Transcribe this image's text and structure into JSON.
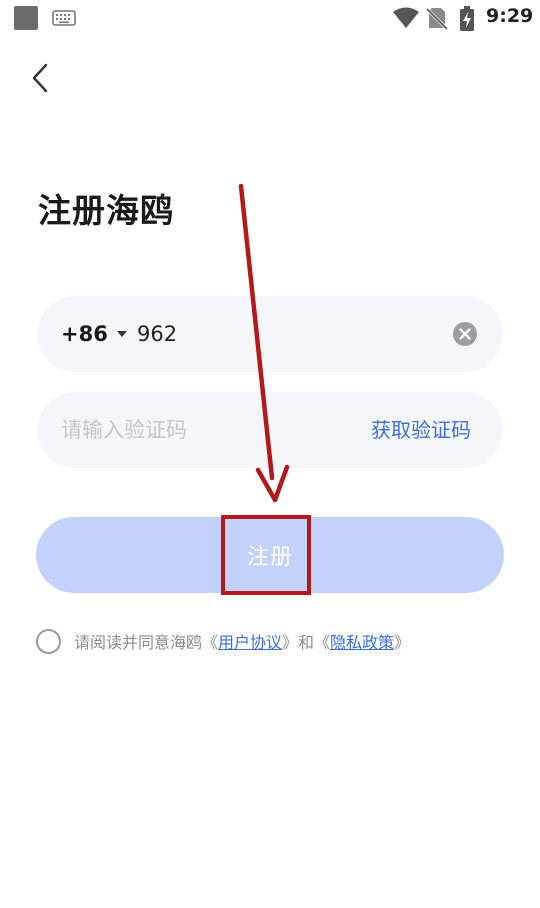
{
  "status_bar": {
    "time": "9:29",
    "icons": [
      "notification-square-icon",
      "keyboard-icon",
      "wifi-icon",
      "no-sim-icon",
      "battery-charging-icon"
    ]
  },
  "nav": {
    "back_icon": "chevron-left-icon"
  },
  "page": {
    "title": "注册海鸥"
  },
  "phone_field": {
    "country_code": "+86",
    "value": "962",
    "clear_icon": "clear-circle-icon"
  },
  "code_field": {
    "placeholder": "请输入验证码",
    "get_code_label": "获取验证码"
  },
  "register_button": {
    "label": "注册"
  },
  "agreement": {
    "prefix": "请阅读并同意海鸥《",
    "terms_link": "用户协议",
    "middle": "》和《",
    "privacy_link": "隐私政策",
    "suffix": "》"
  },
  "colors": {
    "accent": "#3c6ee0",
    "button_disabled": "#c3d2fb",
    "field_bg": "#f5f6f8",
    "annotation_red": "#b3191b"
  }
}
